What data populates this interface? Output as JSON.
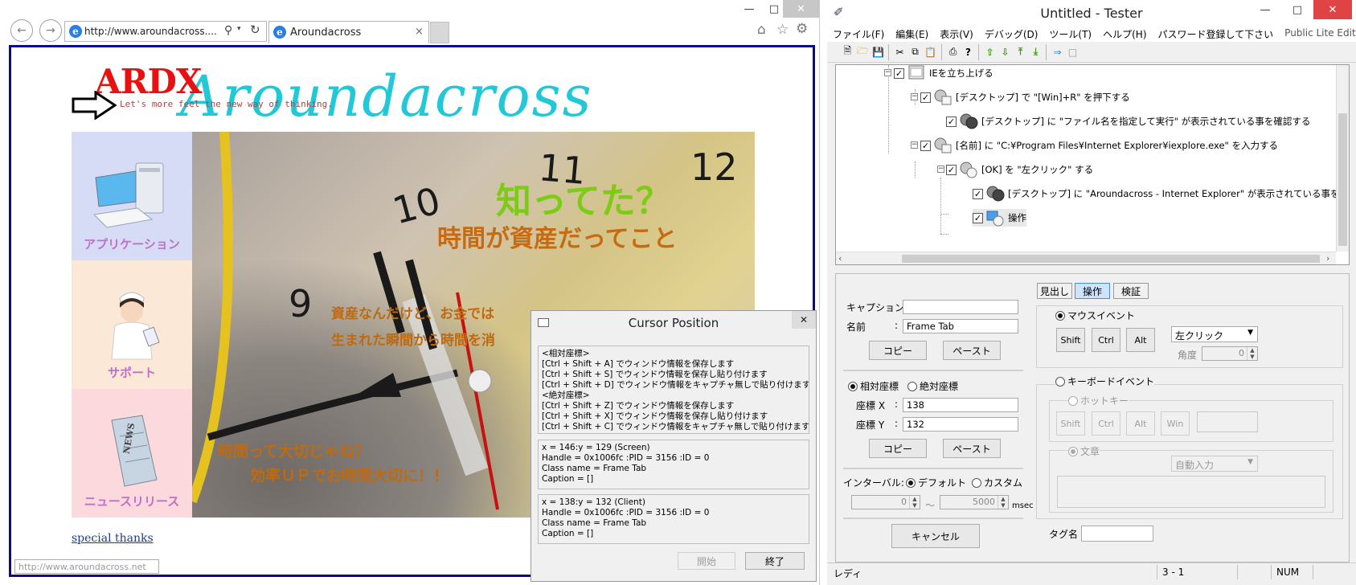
{
  "browser": {
    "address": "http://www.aroundacross....",
    "tab_title": "Aroundacross",
    "status_url": "http://www.aroundacross.net"
  },
  "page": {
    "logo_text": "ARDX",
    "script_logo": "Aroundacross",
    "tagline": "Let's more feel the new way of thinking.",
    "side_nav": [
      {
        "label": "アプリケーション",
        "bg": "#d6dcf5"
      },
      {
        "label": "サポート",
        "bg": "#fbe8d6"
      },
      {
        "label": "ニュースリリース",
        "bg": "#fbd9dd"
      }
    ],
    "hero": {
      "headline1": "知ってた？",
      "headline2": "時間が資産だってこと",
      "line3": "資産なんだけど、お金では",
      "line4": "生まれた瞬間から時間を消",
      "line5": "時間って大切じゃね？",
      "line6": "効率ＵＰでお時間大切に！！",
      "clock_numbers": [
        "11",
        "12",
        "10",
        "9"
      ]
    },
    "special_thanks": "special thanks"
  },
  "cursor_dialog": {
    "title": "Cursor Position",
    "help_lines": [
      "<相対座標>",
      "[Ctrl + Shift + A] でウィンドウ情報を保存します",
      "[Ctrl + Shift + S] でウィンドウ情報を保存し貼り付けます",
      "[Ctrl + Shift + D] でウィンドウ情報をキャプチャ無しで貼り付けます",
      "<絶対座標>",
      "[Ctrl + Shift + Z] でウィンドウ情報を保存します",
      "[Ctrl + Shift + X] でウィンドウ情報を保存し貼り付けます",
      "[Ctrl + Shift + C] でウィンドウ情報をキャプチャ無しで貼り付けます"
    ],
    "screen_info": [
      "x =  146:y =  129  (Screen)",
      "Handle = 0x1006fc  :PID = 3156  :ID = 0",
      "Class name = Frame Tab",
      "Caption = []"
    ],
    "client_info": [
      "x =  138:y =  132  (Client)",
      "Handle = 0x1006fc  :PID = 3156  :ID = 0",
      "Class name = Frame Tab",
      "Caption = []"
    ],
    "start_button": "開始",
    "end_button": "終了"
  },
  "tester": {
    "title": "Untitled - Tester",
    "menu": [
      "ファイル(F)",
      "編集(E)",
      "表示(V)",
      "デバッグ(D)",
      "ツール(T)",
      "ヘルプ(H)",
      "パスワード登録して下さい"
    ],
    "edition": "Public Lite Edition",
    "tree": [
      {
        "text": "IEを立ち上げる",
        "checked": true
      },
      {
        "text": "[デスクトップ] で \"[Win]+R\" を押下する",
        "checked": true
      },
      {
        "text": "[デスクトップ] に \"ファイル名を指定して実行\" が表示されている事を確認する",
        "checked": true
      },
      {
        "text": "[名前] に \"C:¥Program Files¥Internet Explorer¥iexplore.exe\" を入力する",
        "checked": true
      },
      {
        "text": "[OK] を \"左クリック\" する",
        "checked": true
      },
      {
        "text": "[デスクトップ] に \"Aroundacross - Internet Explorer\" が表示されている事を確",
        "checked": true
      },
      {
        "text": "操作",
        "checked": true
      }
    ],
    "form": {
      "caption_label": "キャプション:",
      "caption_value": "",
      "name_label": "名前",
      "name_value": "Frame Tab",
      "copy_label": "コピー",
      "paste_label": "ペースト",
      "relative_label": "相対座標",
      "absolute_label": "絶対座標",
      "x_label": "座標 X",
      "x_value": "138",
      "y_label": "座標 Y",
      "y_value": "132",
      "interval_label": "インターバル:",
      "default_label": "デフォルト",
      "custom_label": "カスタム",
      "interval_from": "0",
      "tilde": "～",
      "interval_to": "5000",
      "msec": "msec",
      "cancel_label": "キャンセル"
    },
    "tabs": [
      "見出し",
      "操作",
      "検証"
    ],
    "right": {
      "mouse_event": "マウスイベント",
      "shift": "Shift",
      "ctrl": "Ctrl",
      "alt": "Alt",
      "click_type": "左クリック",
      "angle_label": "角度",
      "angle_value": "0",
      "keyboard_event": "キーボードイベント",
      "hotkey": "ホットキー",
      "win": "Win",
      "sentence": "文章",
      "auto_input": "自動入力",
      "tag_label": "タグ名",
      "tag_value": ""
    },
    "status": {
      "ready": "レディ",
      "position": "3 -   1",
      "num": "NUM"
    }
  }
}
